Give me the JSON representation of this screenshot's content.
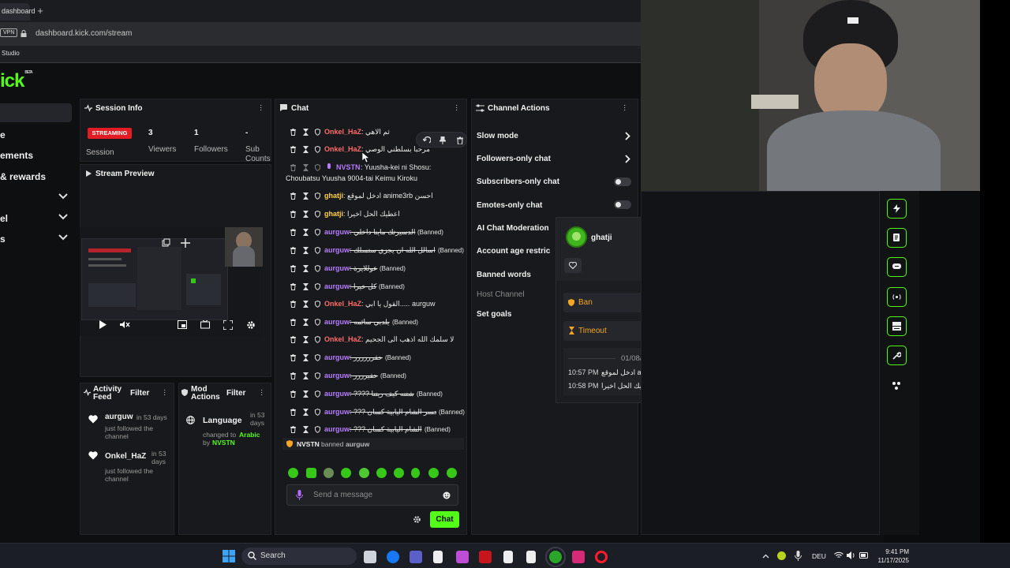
{
  "browser": {
    "tab_label": "dashboard",
    "vpn_label": "VPN",
    "url": "dashboard.kick.com/stream",
    "bookmark": "Studio"
  },
  "brand": {
    "logo": "ick",
    "beta": "BETA"
  },
  "sidebar": {
    "items": [
      {
        "label": "e"
      },
      {
        "label": "ements"
      },
      {
        "label": "& rewards"
      },
      {
        "label": ""
      },
      {
        "label": "el"
      },
      {
        "label": "s"
      }
    ]
  },
  "session": {
    "title": "Session Info",
    "status": "STREAMING",
    "status_label": "Session",
    "viewers": "3",
    "viewers_label": "Viewers",
    "followers": "1",
    "followers_label": "Followers",
    "subs": "-",
    "subs_label": "Sub Counts"
  },
  "preview": {
    "title": "Stream Preview"
  },
  "activity": {
    "title": "Activity Feed",
    "filter": "Filter",
    "items": [
      {
        "user": "aurguw",
        "when": "in 53 days",
        "text": "just followed the channel"
      },
      {
        "user": "Onkel_HaZ",
        "when": "in 53 days",
        "text": "just followed the channel"
      }
    ]
  },
  "mod_actions": {
    "title": "Mod Actions",
    "filter": "Filter",
    "item": {
      "label": "Language",
      "when": "in 53 days",
      "text1": "changed to",
      "value": "Arabic",
      "by": "by",
      "user": "NVSTN"
    }
  },
  "chat": {
    "title": "Chat",
    "messages": [
      {
        "user": "Onkel_HaZ",
        "color": "#ff6b6b",
        "text": "ثم الاهي",
        "banned": ""
      },
      {
        "user": "Onkel_HaZ",
        "color": "#ff6b6b",
        "text": "مرحبا بسلطني الوصي",
        "banned": ""
      },
      {
        "user": "NVSTN",
        "color": "#b67cff",
        "text": "Yuusha-kei ni Shosu:",
        "banned": ""
      },
      {
        "user": "",
        "color": "",
        "text": "Choubatsu Yuusha 9004-tai Keimu Kiroku",
        "banned": ""
      },
      {
        "user": "ghatji",
        "color": "#ffd23f",
        "text": "ادخل لموقع anime3rb احسن",
        "banned": ""
      },
      {
        "user": "ghatji",
        "color": "#ffd23f",
        "text": "اعطيك الحل اخيرا",
        "banned": ""
      },
      {
        "user": "aurguw",
        "color": "#b67cff",
        "text": "الدسيرتك ماينا داخلي",
        "banned": "(Banned)"
      },
      {
        "user": "aurguw",
        "color": "#b67cff",
        "text": "اسالل الله ان يجزي ستسلك",
        "banned": "(Banned)"
      },
      {
        "user": "aurguw",
        "color": "#b67cff",
        "text": "عوللايرة",
        "banned": "(Banned)"
      },
      {
        "user": "aurguw",
        "color": "#b67cff",
        "text": "كل خيرا",
        "banned": "(Banned)"
      },
      {
        "user": "Onkel_HaZ",
        "color": "#ff6b6b",
        "text": "القول يا ابي.....",
        "banned": "aurguw"
      },
      {
        "user": "aurguw",
        "color": "#b67cff",
        "text": "يلدبي سائمه",
        "banned": "(Banned)"
      },
      {
        "user": "Onkel_HaZ",
        "color": "#ff6b6b",
        "text": "لا سلمك الله اذهب الى الجحيم",
        "banned": ""
      },
      {
        "user": "aurguw",
        "color": "#b67cff",
        "text": "حقرررررر",
        "banned": "(Banned)"
      },
      {
        "user": "aurguw",
        "color": "#b67cff",
        "text": "حقيرررر",
        "banned": "(Banned)"
      },
      {
        "user": "aurguw",
        "color": "#b67cff",
        "text": "???? شتنه كيف ريتنا",
        "banned": "(Banned)"
      },
      {
        "user": "aurguw",
        "color": "#b67cff",
        "text": "??? يتحسر الشام اليابية كسان",
        "banned": "(Banned)"
      },
      {
        "user": "aurguw",
        "color": "#b67cff",
        "text": "??? الشام اليابية كسان",
        "banned": "(Banned)"
      }
    ],
    "mod_notice": {
      "actor": "NVSTN",
      "action": "banned",
      "target": "aurguw"
    },
    "input_placeholder": "Send a message",
    "send_label": "Chat"
  },
  "channel_actions": {
    "title": "Channel Actions",
    "items": [
      {
        "label": "Slow mode"
      },
      {
        "label": "Followers-only chat"
      },
      {
        "label": "Subscribers-only chat"
      },
      {
        "label": "Emotes-only chat"
      },
      {
        "label": "AI Chat Moderation"
      },
      {
        "label": "Account age restric"
      },
      {
        "label": "Banned words"
      },
      {
        "label": "Host Channel"
      },
      {
        "label": "Set goals"
      }
    ]
  },
  "user_card": {
    "username": "ghatji",
    "ban_label": "Ban",
    "timeout_label": "Timeout",
    "date": "01/08/2026",
    "history": [
      {
        "time": "10:57 PM",
        "text": "ادخل لموقع anime3rb احسن"
      },
      {
        "time": "10:58 PM",
        "text": "اعطيك الحل اخيرا"
      }
    ]
  },
  "taskbar": {
    "search": "Search",
    "lang": "DEU",
    "time": "9:41 PM",
    "date": "11/17/2025"
  }
}
